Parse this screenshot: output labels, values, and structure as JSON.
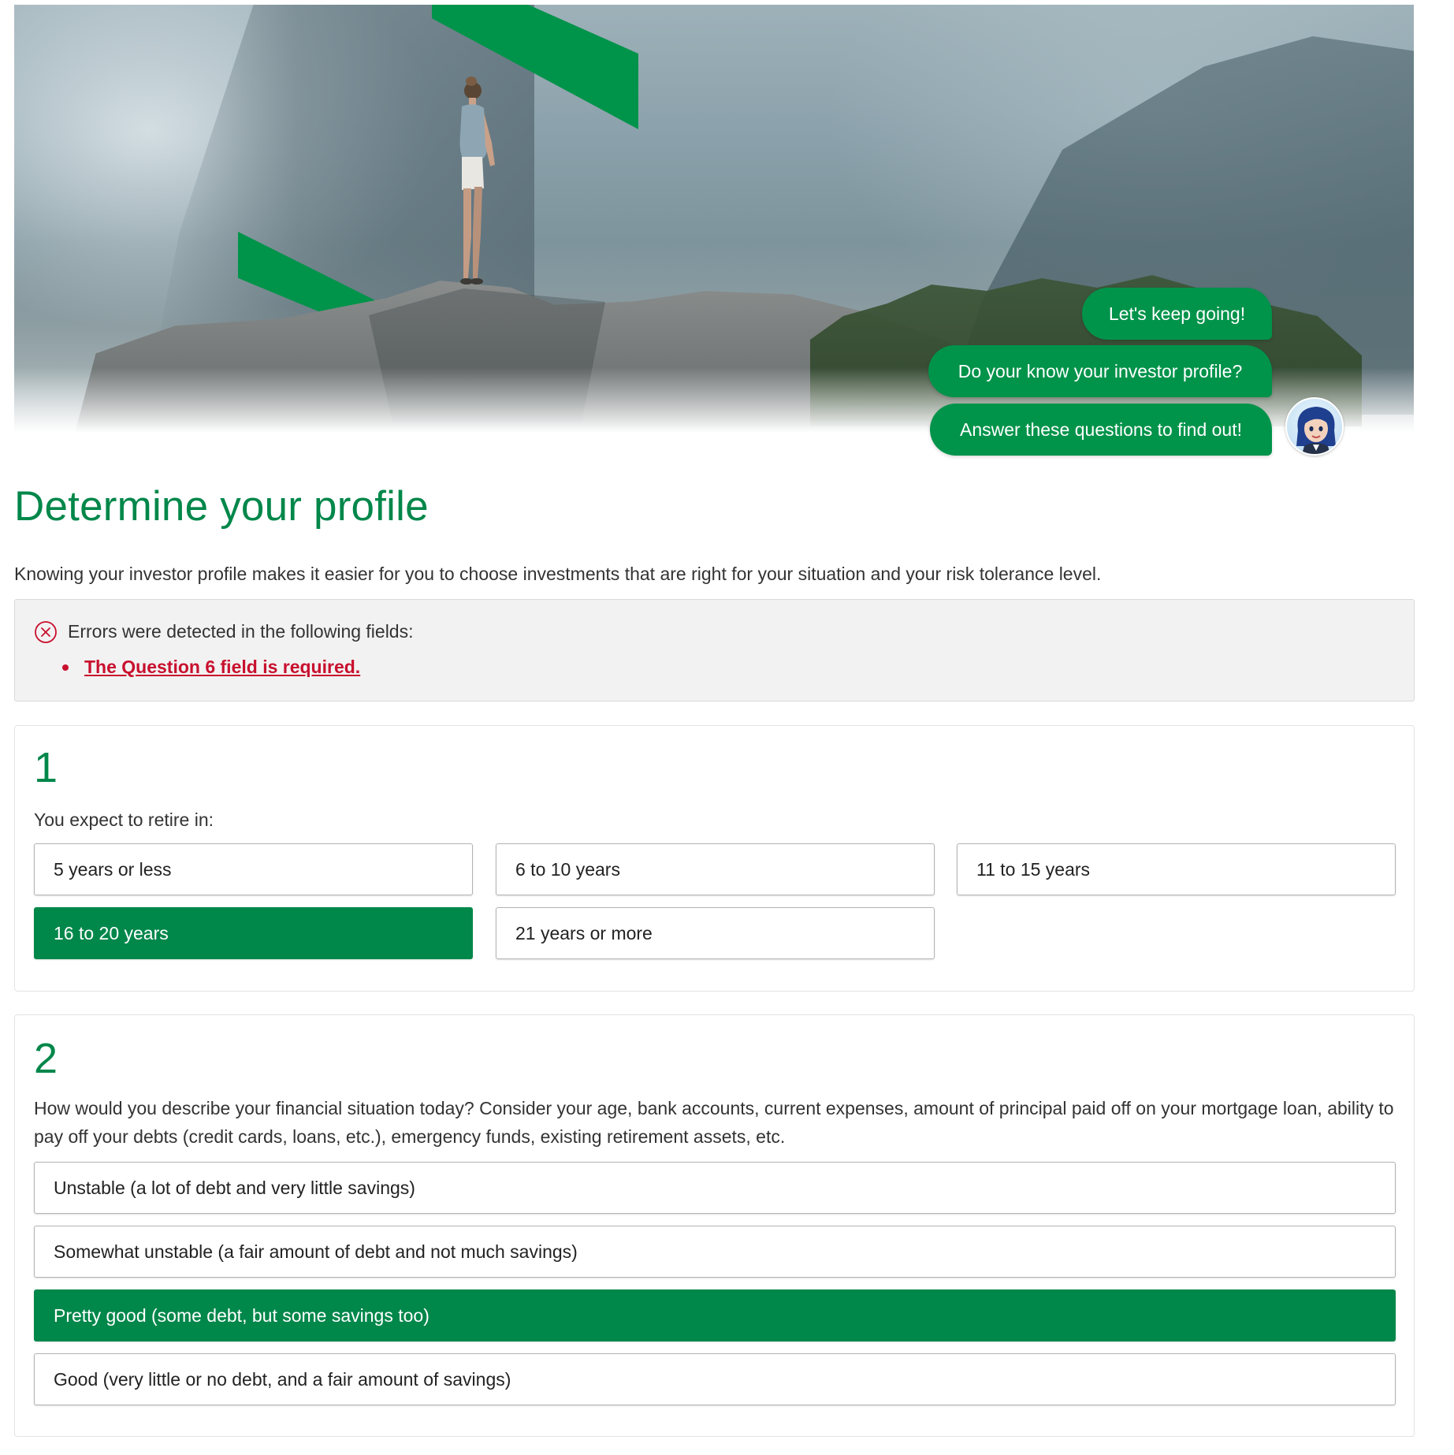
{
  "hero": {
    "chat": [
      "Let's keep going!",
      "Do your know your investor profile?",
      "Answer these questions to find out!"
    ]
  },
  "page": {
    "title": "Determine your profile",
    "intro": "Knowing your investor profile makes it easier for you to choose investments that are right for your situation and your risk tolerance level."
  },
  "errors": {
    "heading": "Errors were detected in the following fields:",
    "items": [
      "The Question 6 field is required."
    ]
  },
  "questions": [
    {
      "number": "1",
      "text": "You expect to retire in:",
      "options": [
        "5 years or less",
        "6 to 10 years",
        "11 to 15 years",
        "16 to 20 years",
        "21 years or more"
      ],
      "selected": "16 to 20 years"
    },
    {
      "number": "2",
      "text": "How would you describe your financial situation today? Consider your age, bank accounts, current expenses, amount of principal paid off on your mortgage loan, ability to pay off your debts (credit cards, loans, etc.), emergency funds, existing retirement assets, etc.",
      "options": [
        "Unstable (a lot of debt and very little savings)",
        "Somewhat unstable (a fair amount of debt and not much savings)",
        "Pretty good (some debt, but some savings too)",
        "Good (very little or no debt, and a fair amount of savings)"
      ],
      "selected": "Pretty good (some debt, but some savings too)"
    }
  ],
  "colors": {
    "brand_green": "#00874a",
    "bubble_green": "#00934a",
    "error_red": "#c8102e"
  },
  "icons": {
    "error": "circle-x-icon",
    "avatar": "assistant-avatar"
  }
}
